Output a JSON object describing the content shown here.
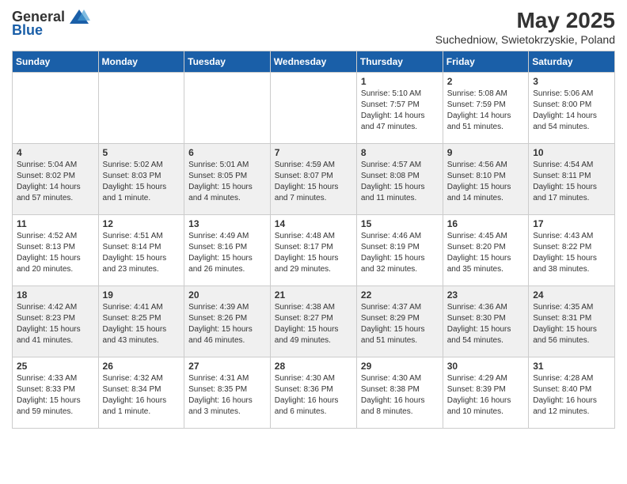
{
  "header": {
    "logo_general": "General",
    "logo_blue": "Blue",
    "month_title": "May 2025",
    "location": "Suchedniow, Swietokrzyskie, Poland"
  },
  "weekdays": [
    "Sunday",
    "Monday",
    "Tuesday",
    "Wednesday",
    "Thursday",
    "Friday",
    "Saturday"
  ],
  "weeks": [
    [
      {
        "day": "",
        "info": ""
      },
      {
        "day": "",
        "info": ""
      },
      {
        "day": "",
        "info": ""
      },
      {
        "day": "",
        "info": ""
      },
      {
        "day": "1",
        "info": "Sunrise: 5:10 AM\nSunset: 7:57 PM\nDaylight: 14 hours\nand 47 minutes."
      },
      {
        "day": "2",
        "info": "Sunrise: 5:08 AM\nSunset: 7:59 PM\nDaylight: 14 hours\nand 51 minutes."
      },
      {
        "day": "3",
        "info": "Sunrise: 5:06 AM\nSunset: 8:00 PM\nDaylight: 14 hours\nand 54 minutes."
      }
    ],
    [
      {
        "day": "4",
        "info": "Sunrise: 5:04 AM\nSunset: 8:02 PM\nDaylight: 14 hours\nand 57 minutes."
      },
      {
        "day": "5",
        "info": "Sunrise: 5:02 AM\nSunset: 8:03 PM\nDaylight: 15 hours\nand 1 minute."
      },
      {
        "day": "6",
        "info": "Sunrise: 5:01 AM\nSunset: 8:05 PM\nDaylight: 15 hours\nand 4 minutes."
      },
      {
        "day": "7",
        "info": "Sunrise: 4:59 AM\nSunset: 8:07 PM\nDaylight: 15 hours\nand 7 minutes."
      },
      {
        "day": "8",
        "info": "Sunrise: 4:57 AM\nSunset: 8:08 PM\nDaylight: 15 hours\nand 11 minutes."
      },
      {
        "day": "9",
        "info": "Sunrise: 4:56 AM\nSunset: 8:10 PM\nDaylight: 15 hours\nand 14 minutes."
      },
      {
        "day": "10",
        "info": "Sunrise: 4:54 AM\nSunset: 8:11 PM\nDaylight: 15 hours\nand 17 minutes."
      }
    ],
    [
      {
        "day": "11",
        "info": "Sunrise: 4:52 AM\nSunset: 8:13 PM\nDaylight: 15 hours\nand 20 minutes."
      },
      {
        "day": "12",
        "info": "Sunrise: 4:51 AM\nSunset: 8:14 PM\nDaylight: 15 hours\nand 23 minutes."
      },
      {
        "day": "13",
        "info": "Sunrise: 4:49 AM\nSunset: 8:16 PM\nDaylight: 15 hours\nand 26 minutes."
      },
      {
        "day": "14",
        "info": "Sunrise: 4:48 AM\nSunset: 8:17 PM\nDaylight: 15 hours\nand 29 minutes."
      },
      {
        "day": "15",
        "info": "Sunrise: 4:46 AM\nSunset: 8:19 PM\nDaylight: 15 hours\nand 32 minutes."
      },
      {
        "day": "16",
        "info": "Sunrise: 4:45 AM\nSunset: 8:20 PM\nDaylight: 15 hours\nand 35 minutes."
      },
      {
        "day": "17",
        "info": "Sunrise: 4:43 AM\nSunset: 8:22 PM\nDaylight: 15 hours\nand 38 minutes."
      }
    ],
    [
      {
        "day": "18",
        "info": "Sunrise: 4:42 AM\nSunset: 8:23 PM\nDaylight: 15 hours\nand 41 minutes."
      },
      {
        "day": "19",
        "info": "Sunrise: 4:41 AM\nSunset: 8:25 PM\nDaylight: 15 hours\nand 43 minutes."
      },
      {
        "day": "20",
        "info": "Sunrise: 4:39 AM\nSunset: 8:26 PM\nDaylight: 15 hours\nand 46 minutes."
      },
      {
        "day": "21",
        "info": "Sunrise: 4:38 AM\nSunset: 8:27 PM\nDaylight: 15 hours\nand 49 minutes."
      },
      {
        "day": "22",
        "info": "Sunrise: 4:37 AM\nSunset: 8:29 PM\nDaylight: 15 hours\nand 51 minutes."
      },
      {
        "day": "23",
        "info": "Sunrise: 4:36 AM\nSunset: 8:30 PM\nDaylight: 15 hours\nand 54 minutes."
      },
      {
        "day": "24",
        "info": "Sunrise: 4:35 AM\nSunset: 8:31 PM\nDaylight: 15 hours\nand 56 minutes."
      }
    ],
    [
      {
        "day": "25",
        "info": "Sunrise: 4:33 AM\nSunset: 8:33 PM\nDaylight: 15 hours\nand 59 minutes."
      },
      {
        "day": "26",
        "info": "Sunrise: 4:32 AM\nSunset: 8:34 PM\nDaylight: 16 hours\nand 1 minute."
      },
      {
        "day": "27",
        "info": "Sunrise: 4:31 AM\nSunset: 8:35 PM\nDaylight: 16 hours\nand 3 minutes."
      },
      {
        "day": "28",
        "info": "Sunrise: 4:30 AM\nSunset: 8:36 PM\nDaylight: 16 hours\nand 6 minutes."
      },
      {
        "day": "29",
        "info": "Sunrise: 4:30 AM\nSunset: 8:38 PM\nDaylight: 16 hours\nand 8 minutes."
      },
      {
        "day": "30",
        "info": "Sunrise: 4:29 AM\nSunset: 8:39 PM\nDaylight: 16 hours\nand 10 minutes."
      },
      {
        "day": "31",
        "info": "Sunrise: 4:28 AM\nSunset: 8:40 PM\nDaylight: 16 hours\nand 12 minutes."
      }
    ]
  ]
}
